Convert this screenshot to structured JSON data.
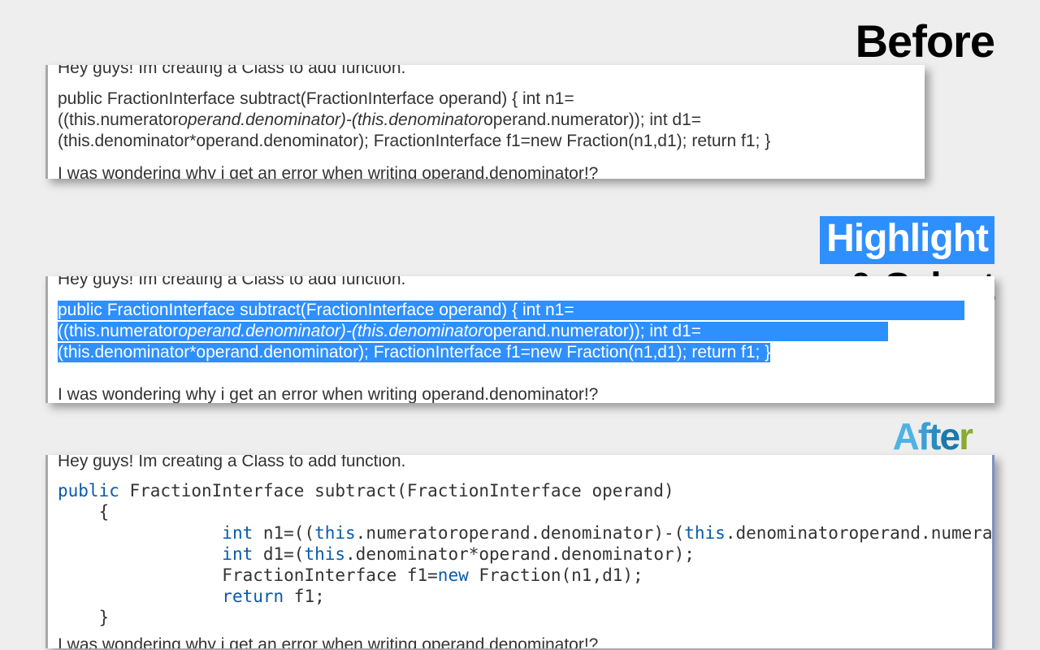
{
  "labels": {
    "before": "Before",
    "highlight": "Highlight",
    "and_select": "& Select",
    "after_chars": [
      "A",
      "f",
      "t",
      "e",
      "r"
    ]
  },
  "text": {
    "intro": "Hey guys! Im creating a Class to add function.",
    "outro": "I was wondering why i get an error when writing operand.denominator!?"
  },
  "before_code": {
    "l1a": "public FractionInterface subtract(FractionInterface operand) { int n1=",
    "l2_pre": "((this.numerator",
    "l2_it": "operand.denominator)-(this.denominator",
    "l2_post": "operand.numerator)); int d1=",
    "l3": "(this.denominator*operand.denominator); FractionInterface f1=new Fraction(n1,d1); return f1; }"
  },
  "highlight_code": {
    "l1": "public FractionInterface subtract(FractionInterface operand) { int n1=",
    "l2_pre": "((this.numerator",
    "l2_it": "operand.denominator)-(this.denominator",
    "l2_post": "operand.numerator)); int d1=",
    "l3": "(this.denominator*operand.denominator); FractionInterface f1=new Fraction(n1,d1); return f1; }"
  },
  "after_code": {
    "l1_kw": "public",
    "l1_rest": " FractionInterface subtract(FractionInterface operand)",
    "l2": "    {",
    "l3_pre": "                ",
    "l3_int": "int",
    "l3_mid": " n1=((",
    "l3_this1": "this",
    "l3_a": ".numeratoroperand.denominator)-(",
    "l3_this2": "this",
    "l3_b": ".denominatoroperand.numerator));",
    "l4_pre": "                ",
    "l4_int": "int",
    "l4_mid": " d1=(",
    "l4_this": "this",
    "l4_b": ".denominator*operand.denominator);",
    "l5_pre": "                FractionInterface f1=",
    "l5_new": "new",
    "l5_post": " Fraction(n1,d1);",
    "l6_pre": "                ",
    "l6_ret": "return",
    "l6_post": " f1;",
    "l7": "    }"
  }
}
